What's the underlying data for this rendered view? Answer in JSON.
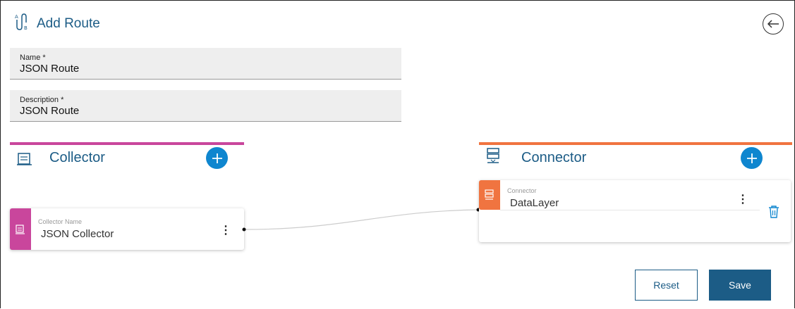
{
  "header": {
    "title": "Add Route",
    "icon": "route-icon",
    "back_icon": "back-arrow-icon"
  },
  "form": {
    "name": {
      "label": "Name *",
      "value": "JSON Route"
    },
    "description": {
      "label": "Description *",
      "value": "JSON Route"
    }
  },
  "collector": {
    "title": "Collector",
    "accent": "#c9469c",
    "card": {
      "label": "Collector Name",
      "value": "JSON Collector"
    }
  },
  "connector": {
    "title": "Connector",
    "accent": "#f07440",
    "card": {
      "label": "Connector",
      "value": "DataLayer"
    }
  },
  "actions": {
    "reset": "Reset",
    "save": "Save"
  }
}
